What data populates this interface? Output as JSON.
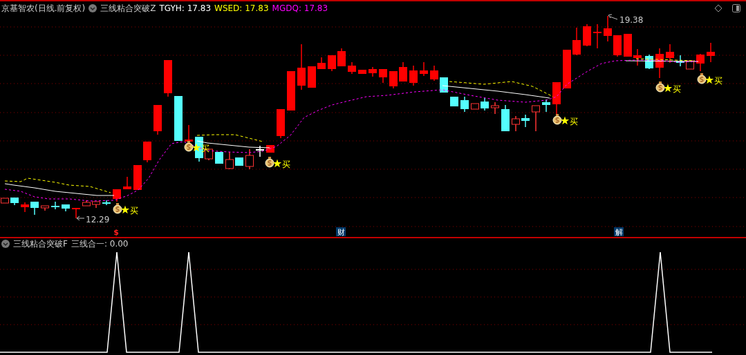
{
  "main_panel": {
    "stock": "京基智农(日线.前复权)",
    "indicator": "三线粘合突破Z",
    "readings": [
      {
        "label": "TGYH: 17.83",
        "color": "#ffffff"
      },
      {
        "label": "WSED: 17.83",
        "color": "#ffff00"
      },
      {
        "label": "MGDQ: 17.83",
        "color": "#ff00ff"
      }
    ],
    "high_label": "19.38",
    "low_label": "12.29",
    "buy_signals": [
      {
        "label": "买"
      },
      {
        "label": "买"
      },
      {
        "label": "买"
      },
      {
        "label": "买"
      },
      {
        "label": "买"
      },
      {
        "label": "买"
      }
    ],
    "axis_marks": [
      {
        "label": "$",
        "kind": "dividend"
      },
      {
        "label": "财",
        "kind": "finance"
      },
      {
        "label": "解",
        "kind": "unlock"
      }
    ]
  },
  "sub_panel": {
    "indicator": "三线粘合突破F",
    "reading": "三线合一: 0.00"
  }
}
